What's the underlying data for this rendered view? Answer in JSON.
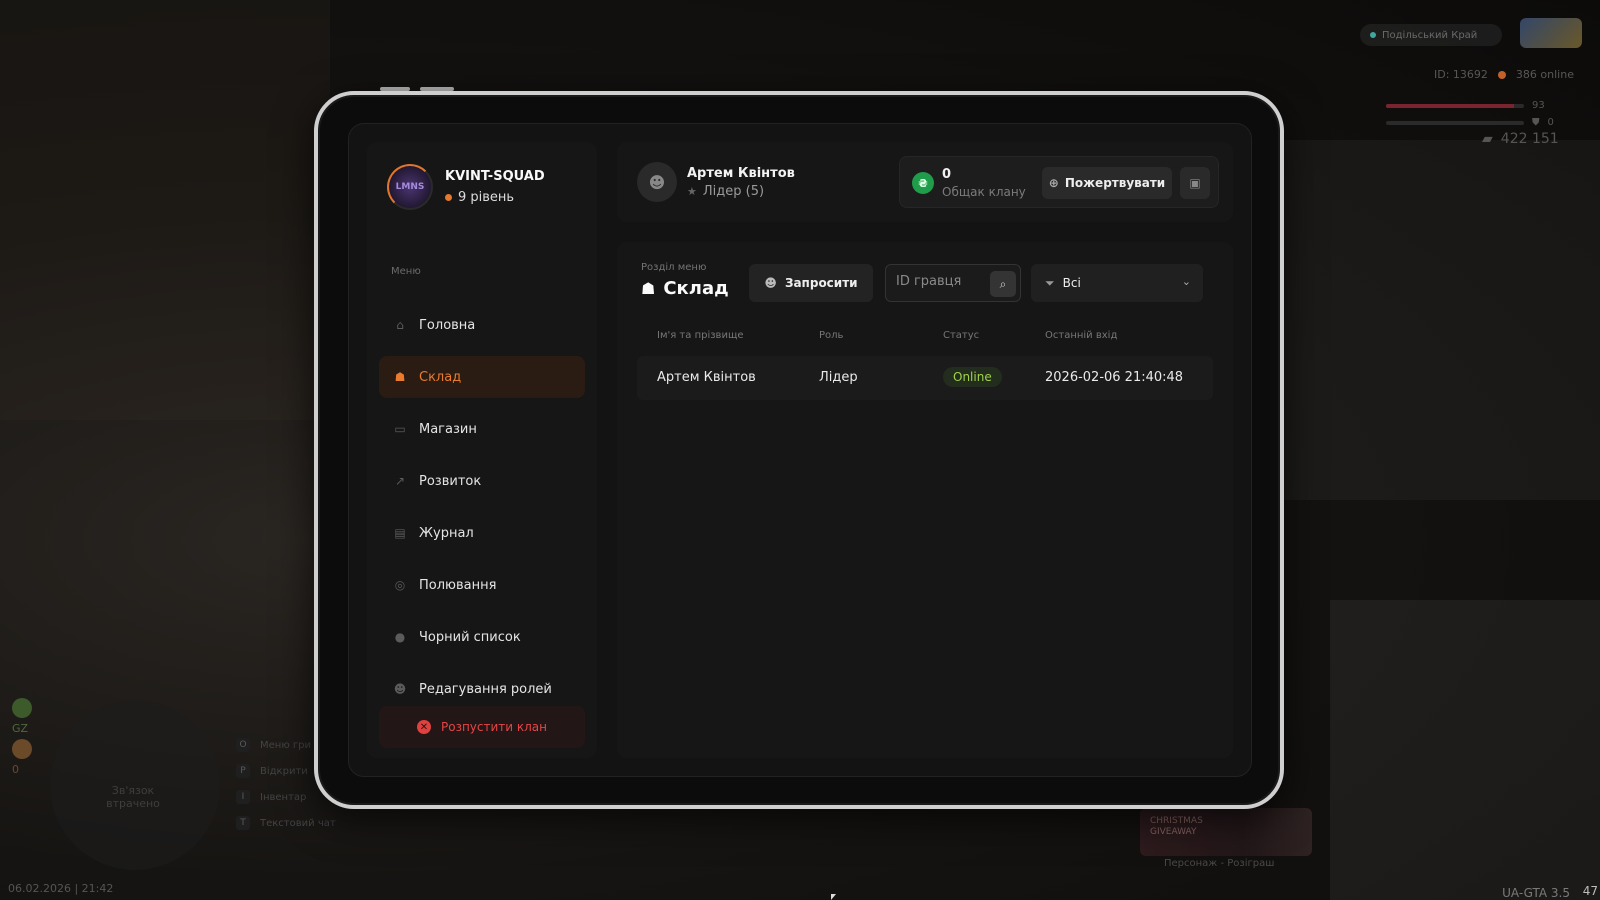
{
  "hud": {
    "server_name": "Подільський Край",
    "player_id": "ID: 13692",
    "online": "386 online",
    "health": "93",
    "health_fraction": 0.93,
    "armor": "0",
    "armor_fraction": 0.0,
    "money": "422 151",
    "left_badge": "GZ",
    "left_value": "0",
    "radar_text": "Зв'язок втрачено",
    "keys": [
      {
        "key": "O",
        "label": "Меню гри"
      },
      {
        "key": "P",
        "label": "Відкрити"
      },
      {
        "key": "I",
        "label": "Інвентар"
      },
      {
        "key": "T",
        "label": "Текстовий чат"
      }
    ],
    "datetime": "06.02.2026 | 21:42",
    "version": "UA-GTA 3.5",
    "corner_number": "47",
    "giveaway_label": "CHRISTMAS GIVEAWAY",
    "giveaway_hint": "Персонаж - Розіграш"
  },
  "clan": {
    "name": "KVINT-SQUAD",
    "avatar_text": "LMNS",
    "level": "9 рівень"
  },
  "menu": {
    "caption": "Меню",
    "items": [
      {
        "label": "Головна",
        "icon": "home-icon",
        "glyph": "⌂"
      },
      {
        "label": "Склад",
        "icon": "people-icon",
        "glyph": "☗"
      },
      {
        "label": "Магазин",
        "icon": "shop-icon",
        "glyph": "▭"
      },
      {
        "label": "Розвиток",
        "icon": "chart-icon",
        "glyph": "↗"
      },
      {
        "label": "Журнал",
        "icon": "book-icon",
        "glyph": "▤"
      },
      {
        "label": "Полювання",
        "icon": "target-icon",
        "glyph": "◎"
      },
      {
        "label": "Чорний список",
        "icon": "blacklist-icon",
        "glyph": "●"
      },
      {
        "label": "Редагування ролей",
        "icon": "user-edit-icon",
        "glyph": "☻"
      }
    ],
    "active": "Склад",
    "disband_label": "Розпустити клан"
  },
  "user": {
    "name": "Артем Квінтов",
    "role": "Лідер (5)"
  },
  "treasury": {
    "value": "0",
    "caption": "Общак клану",
    "donate_label": "Пожертвувати"
  },
  "section": {
    "caption": "Розділ меню",
    "title": "Склад",
    "invite_label": "Запросити",
    "search_placeholder": "ID гравця",
    "filter_value": "Всі"
  },
  "table": {
    "headers": [
      "Ім'я та прізвище",
      "Роль",
      "Статус",
      "Останній вхід"
    ],
    "rows": [
      [
        "Артем Квінтов",
        "Лідер",
        "Online",
        "2026-02-06 21:40:48"
      ]
    ]
  },
  "colors": {
    "accent": "#ea7a2e",
    "online": "#9fd14a",
    "danger": "#e54545",
    "coin": "#1f9d4a"
  }
}
